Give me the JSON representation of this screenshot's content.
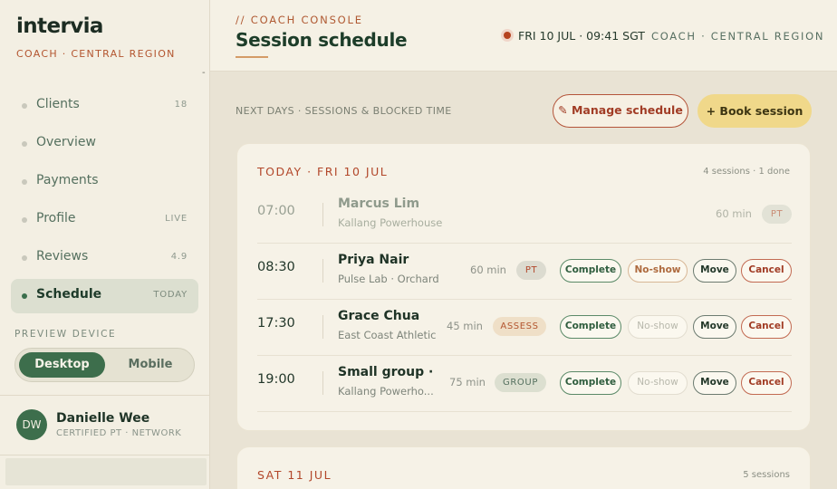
{
  "brand": {
    "name": "intervia",
    "subtitle": "COACH · CENTRAL REGION",
    "dash": "-"
  },
  "sidebar": {
    "items": [
      {
        "label": "Clients",
        "count": "18"
      },
      {
        "label": "Overview",
        "count": ""
      },
      {
        "label": "Payments",
        "count": ""
      },
      {
        "label": "Profile",
        "count": "LIVE"
      },
      {
        "label": "Reviews",
        "count": "4.9"
      },
      {
        "label": "Schedule",
        "count": "TODAY"
      }
    ],
    "active": "Schedule"
  },
  "preview": {
    "label": "PREVIEW DEVICE",
    "options": [
      "Desktop",
      "Mobile"
    ],
    "selected": "Desktop"
  },
  "user": {
    "initials": "DW",
    "name": "Danielle Wee",
    "role": "CERTIFIED PT · NETWORK"
  },
  "header": {
    "crumb": "// COACH CONSOLE",
    "title": "Session schedule",
    "clock": "FRI 10 JUL · 09:41 SGT",
    "region": "COACH · CENTRAL REGION"
  },
  "toolbar": {
    "section_label": "NEXT DAYS · SESSIONS & BLOCKED TIME",
    "manage_label": "✎ Manage schedule",
    "book_label": "+ Book session"
  },
  "days": [
    {
      "title": "TODAY · FRI 10 JUL",
      "meta": "4 sessions · 1 done",
      "sessions": [
        {
          "time": "07:00",
          "client": "Marcus Lim",
          "location": "Kallang Powerhouse",
          "duration": "60 min",
          "tag": "PT",
          "status": "done"
        },
        {
          "time": "08:30",
          "client": "Priya Nair",
          "location": "Pulse Lab · Orchard",
          "duration": "60 min",
          "tag": "PT",
          "status": "upcoming"
        },
        {
          "time": "17:30",
          "client": "Grace Chua",
          "location": "East Coast Athletic",
          "duration": "45 min",
          "tag": "ASSESS",
          "status": "upcoming"
        },
        {
          "time": "19:00",
          "client": "Small group · …",
          "location": "Kallang Powerho...",
          "duration": "75 min",
          "tag": "GROUP",
          "status": "upcoming"
        }
      ]
    },
    {
      "title": "SAT 11 JUL",
      "meta": "5 sessions",
      "sessions": []
    }
  ],
  "actions": {
    "complete": "Complete",
    "noshow": "No-show",
    "move": "Move",
    "cancel": "Cancel"
  },
  "colors": {
    "accent_green": "#3d6e4c",
    "accent_rust": "#b2472a",
    "book_yellow": "#f0d88a",
    "live_red": "#b5431f"
  }
}
